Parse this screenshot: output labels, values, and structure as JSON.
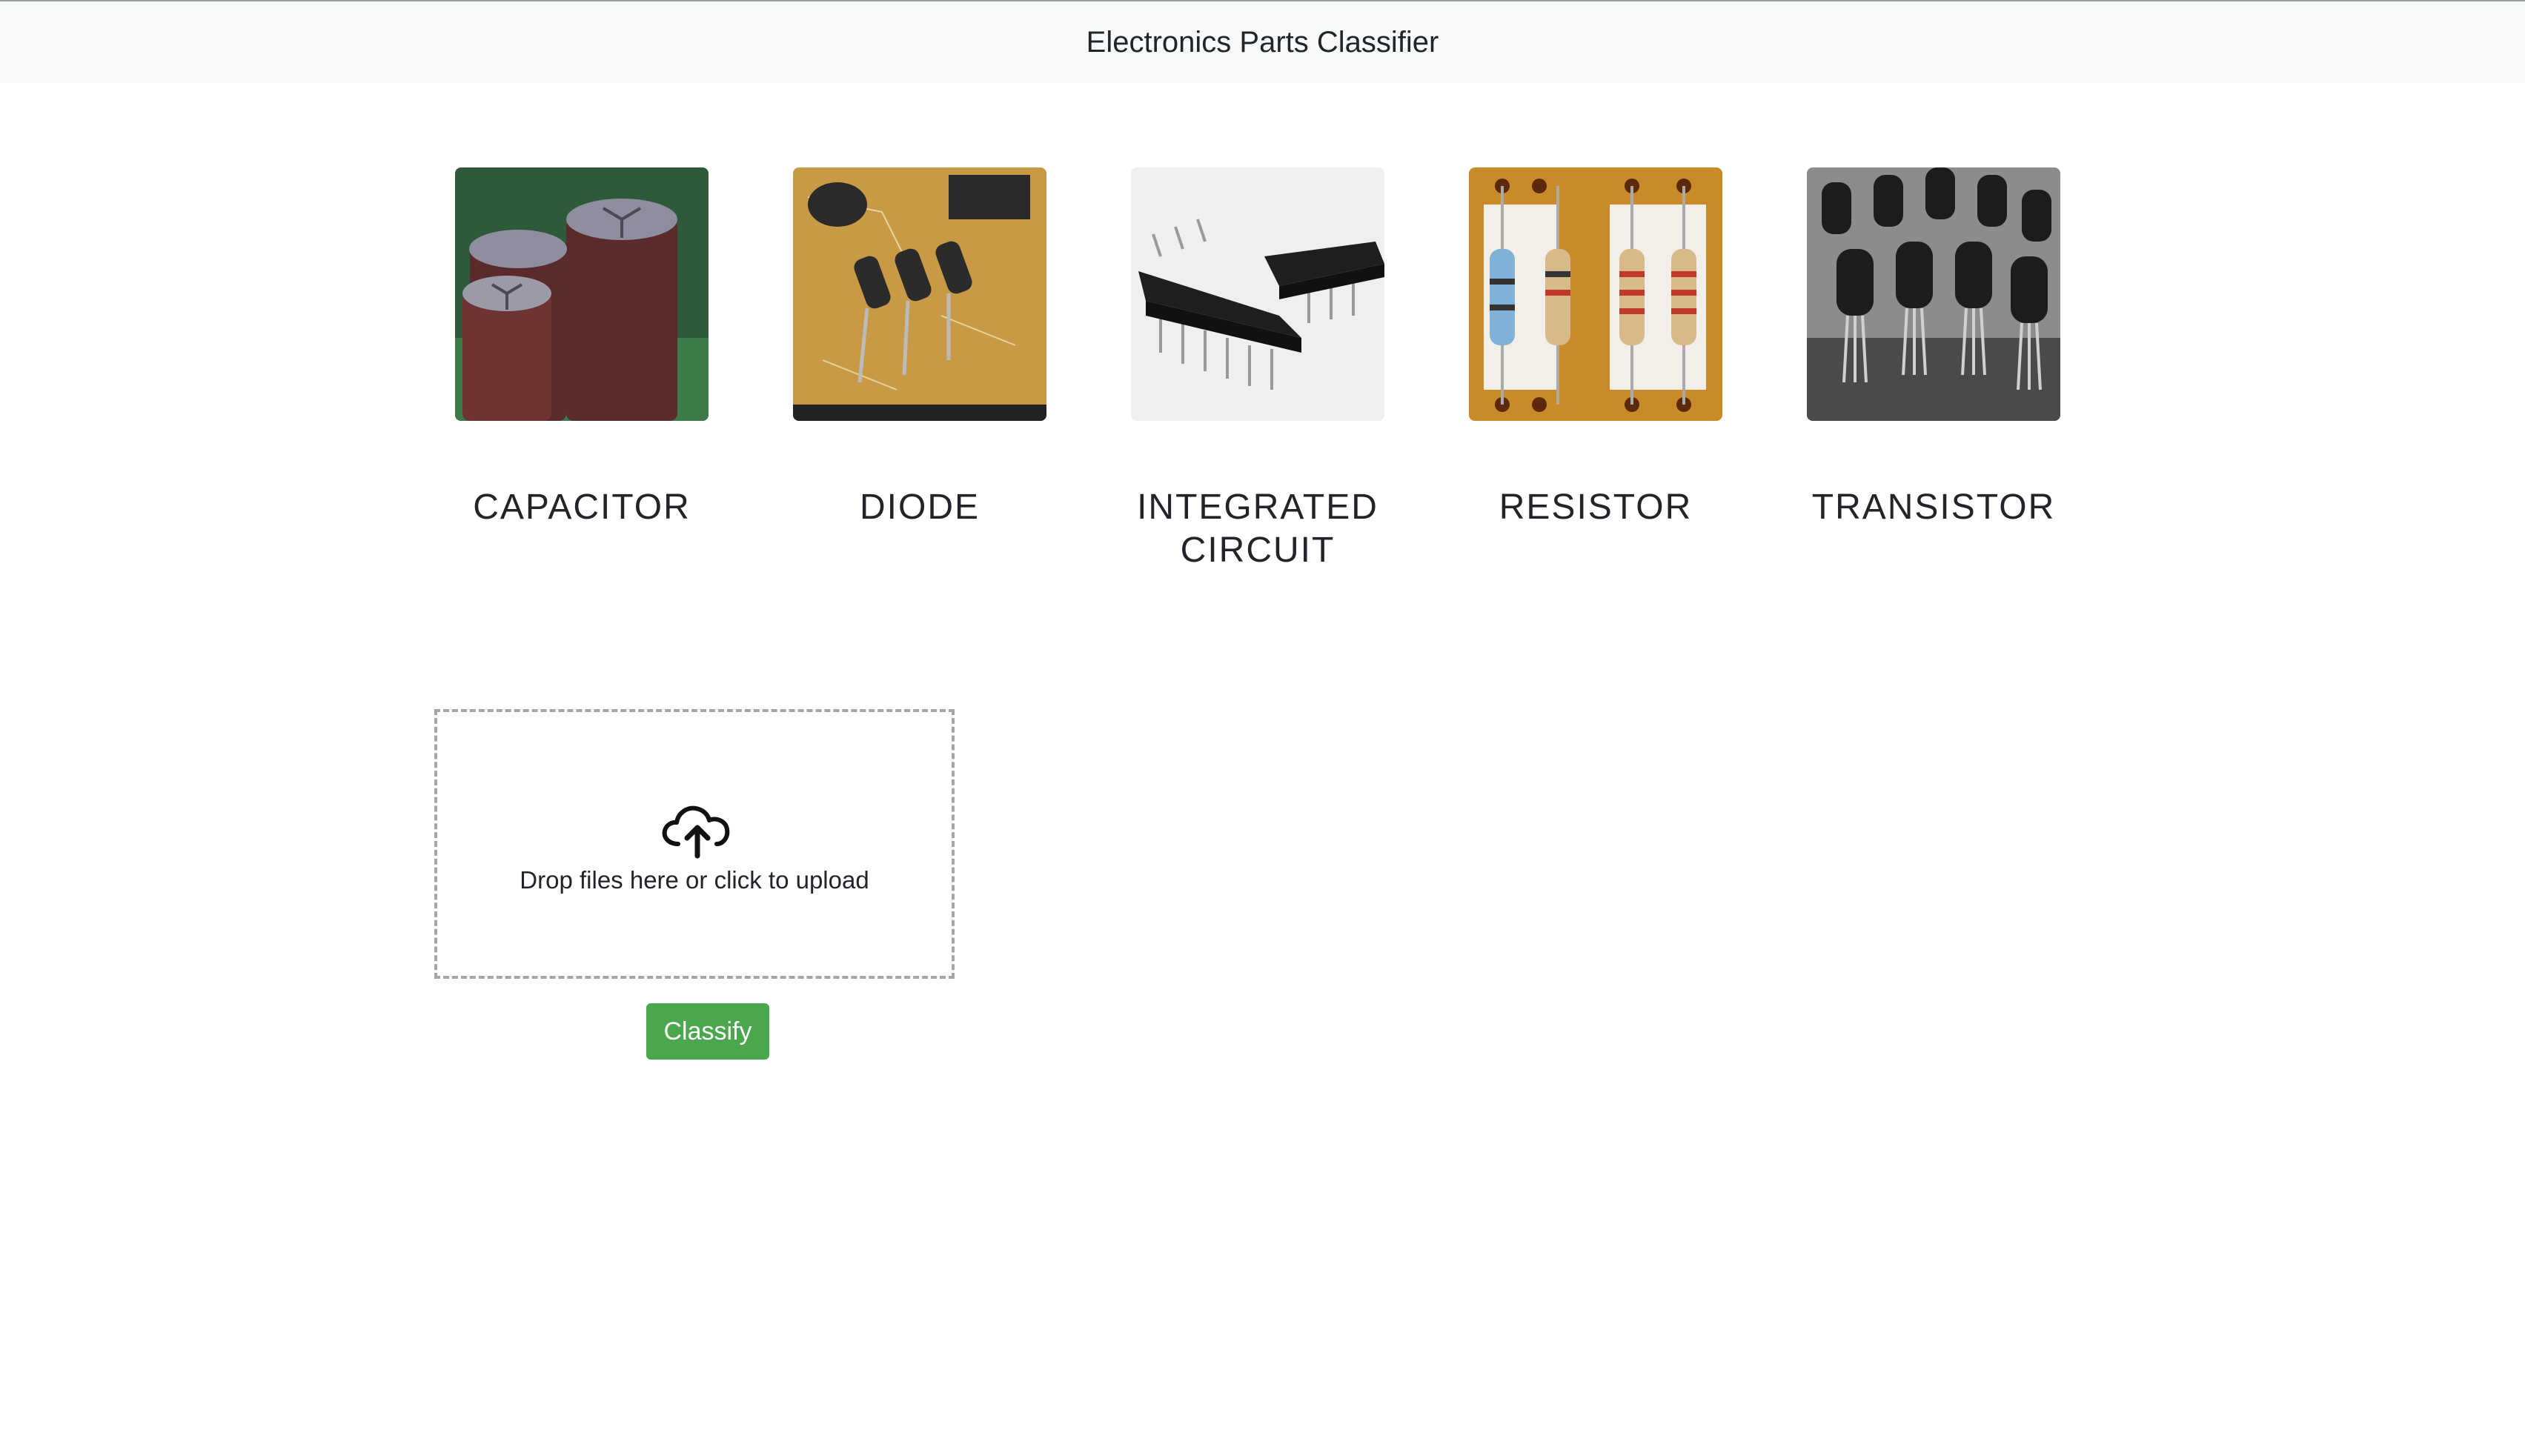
{
  "header": {
    "title": "Electronics Parts Classifier"
  },
  "categories": [
    {
      "label": "CAPACITOR",
      "icon": "capacitor-photo"
    },
    {
      "label": "DIODE",
      "icon": "diode-photo"
    },
    {
      "label": "INTEGRATED\nCIRCUIT",
      "icon": "integrated-circuit-photo"
    },
    {
      "label": "RESISTOR",
      "icon": "resistor-photo"
    },
    {
      "label": "TRANSISTOR",
      "icon": "transistor-photo"
    }
  ],
  "upload": {
    "text": "Drop files here or click to upload",
    "icon": "cloud-upload-icon"
  },
  "classify_button": {
    "label": "Classify"
  },
  "colors": {
    "navbar_bg": "#f8f9fa",
    "button_green": "#4aa74e",
    "dropzone_border": "#a6a6a6"
  }
}
